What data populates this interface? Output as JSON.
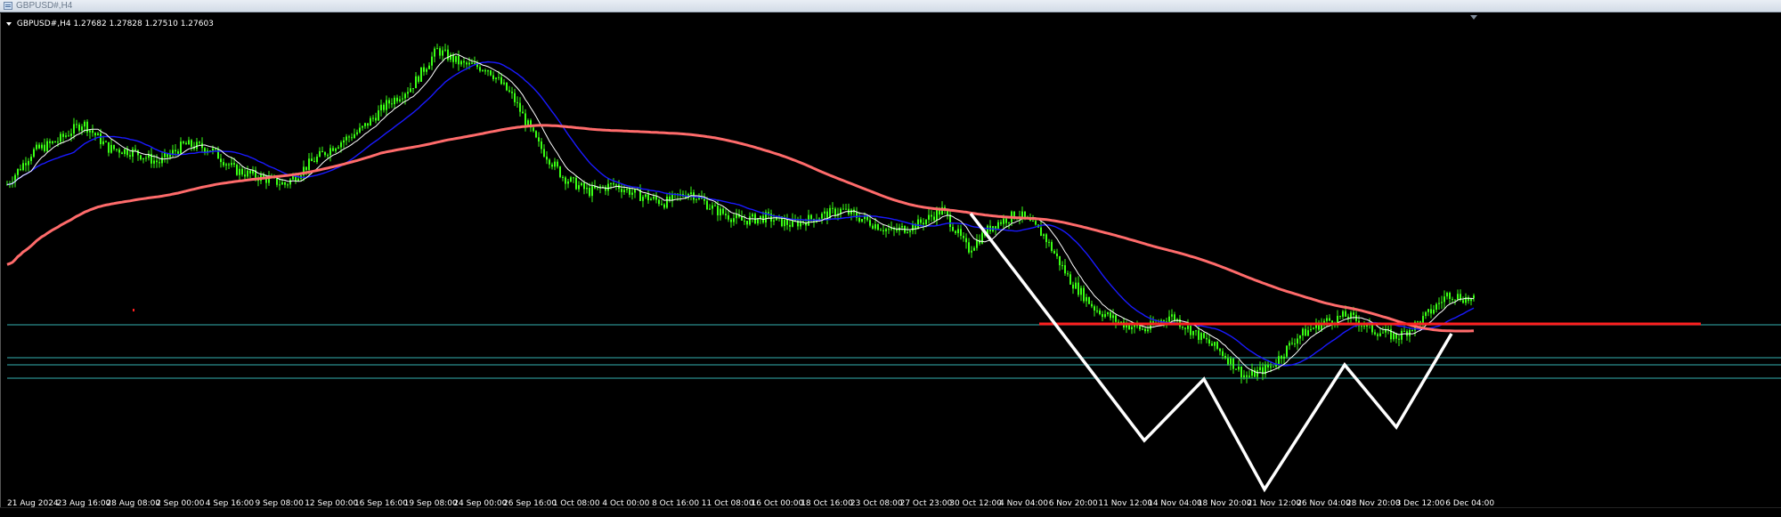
{
  "window": {
    "title": "GBPUSD#,H4"
  },
  "header": {
    "symbol": "GBPUSD#,H4",
    "ohlc": "1.27682 1.27828 1.27510 1.27603",
    "dropdown_icon": "triangle-down-icon"
  },
  "colors": {
    "background": "#000000",
    "candles": "#39ff14",
    "ma_fast": "#ffffff",
    "ma_slow": "#ff6b6b",
    "ma_mid": "#1a1aff",
    "horizontal_levels": "#2a8c8c",
    "support_line": "#ff2020",
    "pattern_lines": "#ffffff"
  },
  "chart_data": {
    "type": "line",
    "symbol": "GBPUSD#",
    "timeframe": "H4",
    "x_tick_labels": [
      "21 Aug 2024",
      "23 Aug 16:00",
      "28 Aug 08:00",
      "2 Sep 00:00",
      "4 Sep 16:00",
      "9 Sep 08:00",
      "12 Sep 00:00",
      "16 Sep 16:00",
      "19 Sep 08:00",
      "24 Sep 00:00",
      "26 Sep 16:00",
      "1 Oct 08:00",
      "4 Oct 00:00",
      "8 Oct 16:00",
      "11 Oct 08:00",
      "16 Oct 00:00",
      "18 Oct 16:00",
      "23 Oct 08:00",
      "27 Oct 23:00",
      "30 Oct 12:00",
      "4 Nov 04:00",
      "6 Nov 20:00",
      "11 Nov 12:00",
      "14 Nov 04:00",
      "18 Nov 20:00",
      "21 Nov 12:00",
      "26 Nov 04:00",
      "28 Nov 20:00",
      "3 Dec 12:00",
      "6 Dec 04:00"
    ],
    "price_path": [
      1.306,
      1.315,
      1.318,
      1.323,
      1.316,
      1.315,
      1.312,
      1.317,
      1.316,
      1.31,
      1.308,
      1.306,
      1.312,
      1.317,
      1.321,
      1.328,
      1.333,
      1.343,
      1.339,
      1.338,
      1.33,
      1.317,
      1.308,
      1.304,
      1.306,
      1.303,
      1.301,
      1.304,
      1.299,
      1.296,
      1.297,
      1.295,
      1.297,
      1.299,
      1.296,
      1.293,
      1.295,
      1.299,
      1.288,
      1.295,
      1.298,
      1.292,
      1.28,
      1.272,
      1.268,
      1.266,
      1.27,
      1.265,
      1.26,
      1.253,
      1.256,
      1.264,
      1.268,
      1.27,
      1.266,
      1.264,
      1.269,
      1.276,
      1.274
    ],
    "annotations": {
      "support_level_label": "",
      "pattern": "zigzag"
    }
  }
}
